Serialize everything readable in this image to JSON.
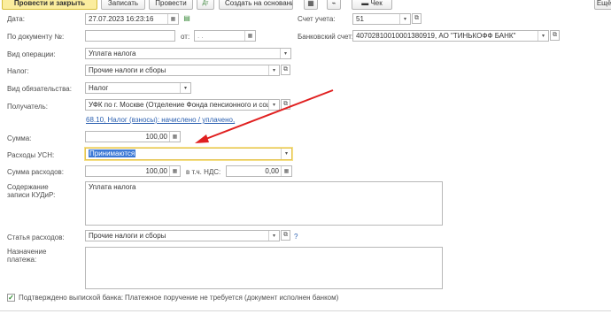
{
  "toolbar": {
    "post_close": "Провести и закрыть",
    "save": "Записать",
    "post": "Провести",
    "create_based": "Создать на основании",
    "check": "Чек",
    "more": "Ещё"
  },
  "form": {
    "date_label": "Дата:",
    "date_value": "27.07.2023 16:23:16",
    "account_label": "Счет учета:",
    "account_value": "51",
    "doc_label": "По документу №:",
    "doc_value": "",
    "from_label": "от:",
    "from_value": ". .",
    "bank_account_label": "Банковский счет:",
    "bank_account_value": "40702810010001380919, АО \"ТИНЬКОФФ БАНК\"",
    "operation_label": "Вид операции:",
    "operation_value": "Уплата налога",
    "tax_label": "Налог:",
    "tax_value": "Прочие налоги и сборы",
    "obligation_label": "Вид обязательства:",
    "obligation_value": "Налог",
    "recipient_label": "Получатель:",
    "recipient_value": "УФК по г. Москве (Отделение Фонда пенсионного и социал",
    "link_text": "68.10, Налог (взносы): начислено / уплачено,",
    "sum_label": "Сумма:",
    "sum_value": "100,00",
    "usn_label": "Расходы УСН:",
    "usn_value": "Принимаются",
    "expense_sum_label": "Сумма расходов:",
    "expense_sum_value": "100,00",
    "vat_label": "в т.ч. НДС:",
    "vat_value": "0,00",
    "kudir_label_1": "Содержание",
    "kudir_label_2": "записи КУДиР:",
    "kudir_value": "Уплата налога",
    "expense_item_label": "Статья расходов:",
    "expense_item_value": "Прочие налоги и сборы",
    "help_mark": "?",
    "purpose_label_1": "Назначение",
    "purpose_label_2": "платежа:",
    "purpose_value": "",
    "confirmed_label": "Подтверждено выпиской банка:",
    "confirmed_status": "Платежное поручение не требуется (документ исполнен банком)"
  },
  "annotation": {
    "arrow_color": "#e02020"
  },
  "colors": {
    "primary_button": "#fbed9e",
    "active_border": "#e5c44f",
    "link": "#2a5fb0"
  }
}
